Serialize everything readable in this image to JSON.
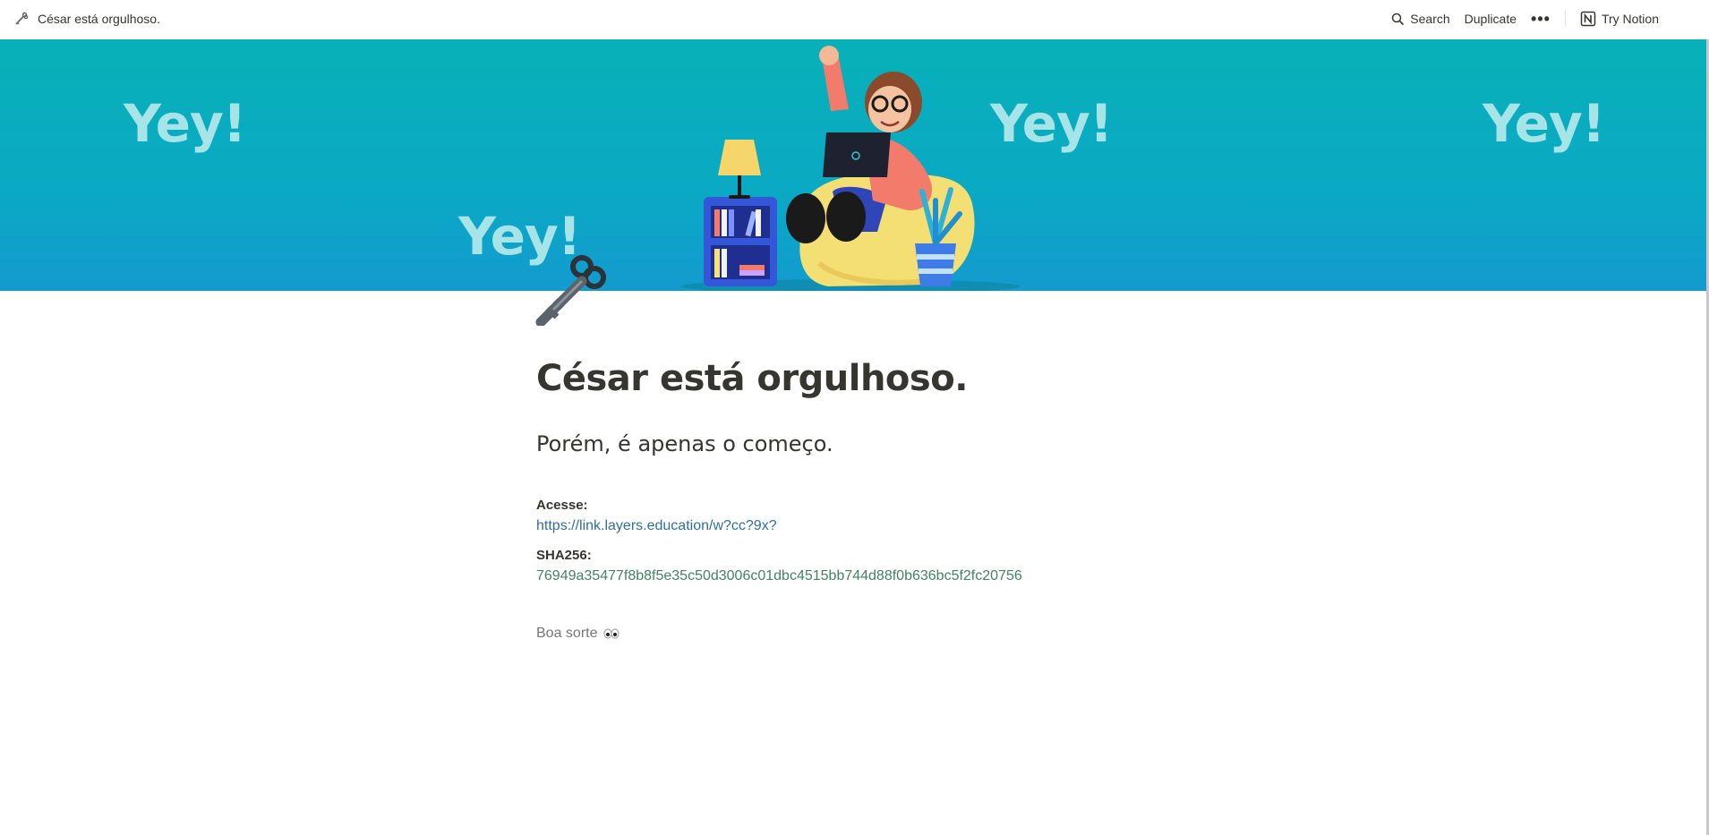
{
  "topbar": {
    "page_title": "César está orgulhoso.",
    "page_icon": "old-key-icon",
    "search_label": "Search",
    "duplicate_label": "Duplicate",
    "more_icon": "more-dots-icon",
    "try_label": "Try Notion",
    "notion_icon": "notion-logo-icon"
  },
  "cover": {
    "texts": [
      "Yey!",
      "Yey!",
      "Yey!",
      "Yey!"
    ],
    "background": "#08b1b8",
    "text_color": "#a6e4e8"
  },
  "page": {
    "icon": "old-key-icon",
    "title": "César está orgulhoso.",
    "subtitle": "Porém, é apenas o começo.",
    "access_label": "Acesse:",
    "access_link": "https://link.layers.education/w?cc?9x?",
    "sha_label": "SHA256:",
    "sha_value": "76949a35477f8b8f5e35c50d3006c01dbc4515bb744d88f0b636bc5f2fc20756",
    "footer_text": "Boa sorte",
    "footer_icon": "eyes-icon"
  },
  "colors": {
    "link": "#2f6f9f",
    "hash": "#448361",
    "text": "#37352f"
  }
}
